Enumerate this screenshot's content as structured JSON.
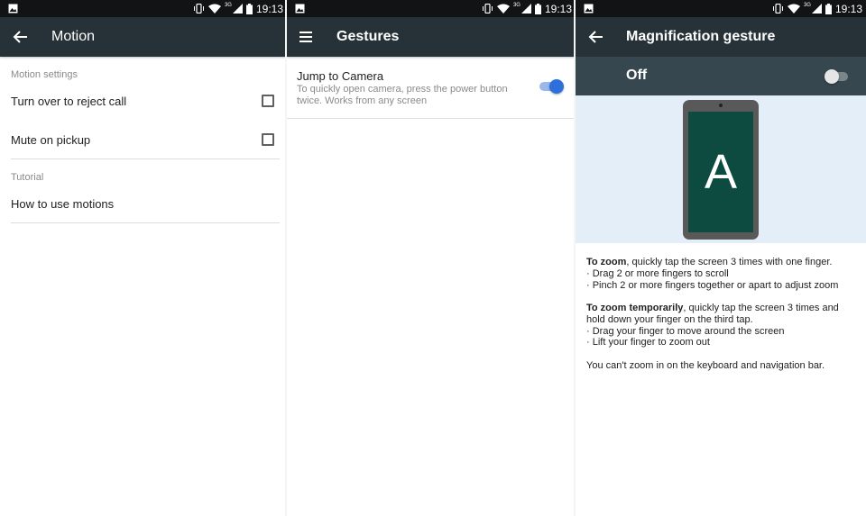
{
  "status_bar": {
    "time": "19:13",
    "network": "3G"
  },
  "panels": {
    "motion": {
      "title": "Motion",
      "section1": "Motion settings",
      "items": [
        {
          "label": "Turn over to reject call",
          "checked": false
        },
        {
          "label": "Mute on pickup",
          "checked": false
        }
      ],
      "section2": "Tutorial",
      "tutorial_item": "How to use motions"
    },
    "gestures": {
      "title": "Gestures",
      "item_title": "Jump to Camera",
      "item_subtitle": "To quickly open camera, press the power button twice. Works from any screen",
      "toggle_on": true
    },
    "magnification": {
      "title": "Magnification gesture",
      "switch_label": "Off",
      "illustration_letter": "A",
      "zoom_bold": "To zoom",
      "zoom_rest": ", quickly tap the screen 3 times with one finger.",
      "zoom_bullets": [
        "· Drag 2 or more fingers to scroll",
        "· Pinch 2 or more fingers together or apart to adjust zoom"
      ],
      "temp_bold": "To zoom temporarily",
      "temp_rest": ", quickly tap the screen 3 times and hold down your finger on the third tap.",
      "temp_bullets": [
        "· Drag your finger to move around the screen",
        "· Lift your finger to zoom out"
      ],
      "note": "You can't zoom in on the keyboard and navigation bar."
    }
  },
  "colors": {
    "status_bar": "#111315",
    "app_bar": "#263238",
    "off_bar": "#37474f",
    "toggle_accent": "#2f6fdb",
    "illustration_bg": "#e3eef8",
    "phone_screen": "#0d4a3f"
  },
  "icons": [
    "image-icon",
    "vibrate-icon",
    "wifi-icon",
    "signal-icon",
    "battery-icon",
    "back-arrow-icon",
    "menu-icon"
  ]
}
